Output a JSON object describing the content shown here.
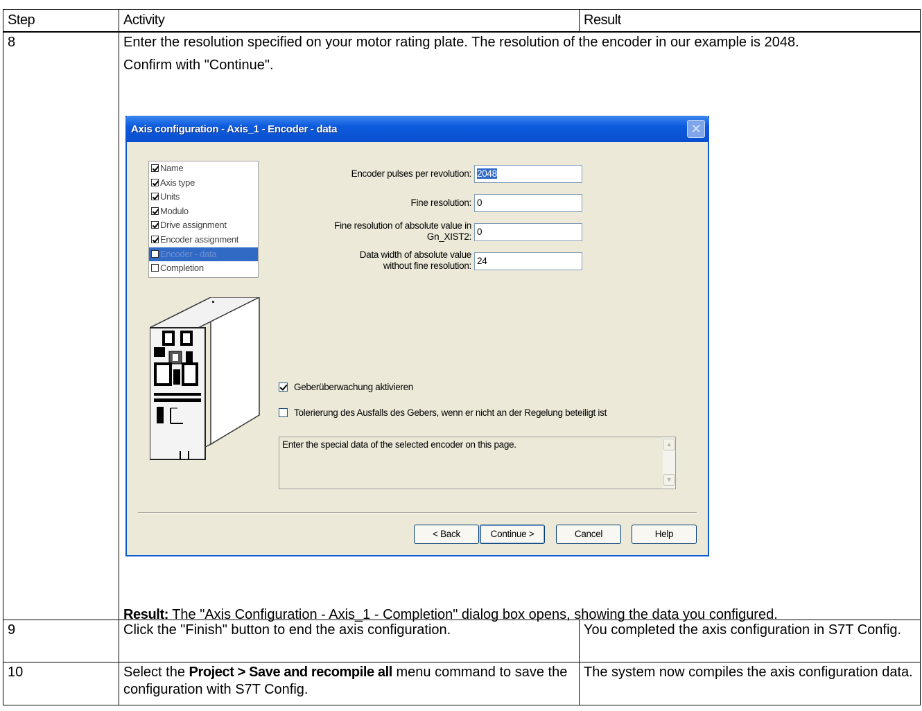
{
  "table": {
    "headers": {
      "step": "Step",
      "activity": "Activity",
      "result": "Result"
    },
    "row8": {
      "step": "8",
      "para1": "Enter the resolution specified on your motor rating plate. The resolution of the encoder in our example is 2048.",
      "para2": "Confirm with \"Continue\".",
      "result_label": "Result:",
      "result_text": " The \"Axis Configuration - Axis_1 - Completion\" dialog box opens, showing the data you configured."
    },
    "row9": {
      "step": "9",
      "activity": "Click the \"Finish\" button to end the axis configuration.",
      "result": "You completed the axis configuration in S7T Config."
    },
    "row10": {
      "step": "10",
      "activity_pre": "Select the ",
      "activity_bold": "Project > Save and recompile all",
      "activity_post": " menu command to save the configuration with S7T Config.",
      "result": "The system now compiles the axis configuration data."
    }
  },
  "dialog": {
    "title": "Axis configuration - Axis_1 - Encoder - data",
    "close_glyph": "✕",
    "steps": [
      {
        "label": "Name",
        "checked": true
      },
      {
        "label": "Axis type",
        "checked": true
      },
      {
        "label": "Units",
        "checked": true
      },
      {
        "label": "Modulo",
        "checked": true
      },
      {
        "label": "Drive assignment",
        "checked": true
      },
      {
        "label": "Encoder assignment",
        "checked": true
      },
      {
        "label": "Encoder - data",
        "checked": false,
        "selected": true
      },
      {
        "label": "Completion",
        "checked": false
      }
    ],
    "fields": {
      "pulses_label": "Encoder pulses per revolution:",
      "pulses_value": "2048",
      "fine_label": "Fine resolution:",
      "fine_value": "0",
      "fine_abs_label_1": "Fine resolution of absolute value in",
      "fine_abs_label_2": "Gn_XIST2:",
      "fine_abs_value": "0",
      "width_label_1": "Data width of absolute value",
      "width_label_2": "without fine resolution:",
      "width_value": "24"
    },
    "check1": {
      "label": "Geberüberwachung aktivieren",
      "checked": true
    },
    "check2": {
      "label": "Tolerierung des  Ausfalls des Gebers, wenn er nicht an der Regelung beteiligt ist",
      "checked": false
    },
    "info_text": "Enter the special data of the selected encoder on this page.",
    "buttons": {
      "back": "< Back",
      "continue": "Continue >",
      "cancel": "Cancel",
      "help": "Help"
    }
  }
}
